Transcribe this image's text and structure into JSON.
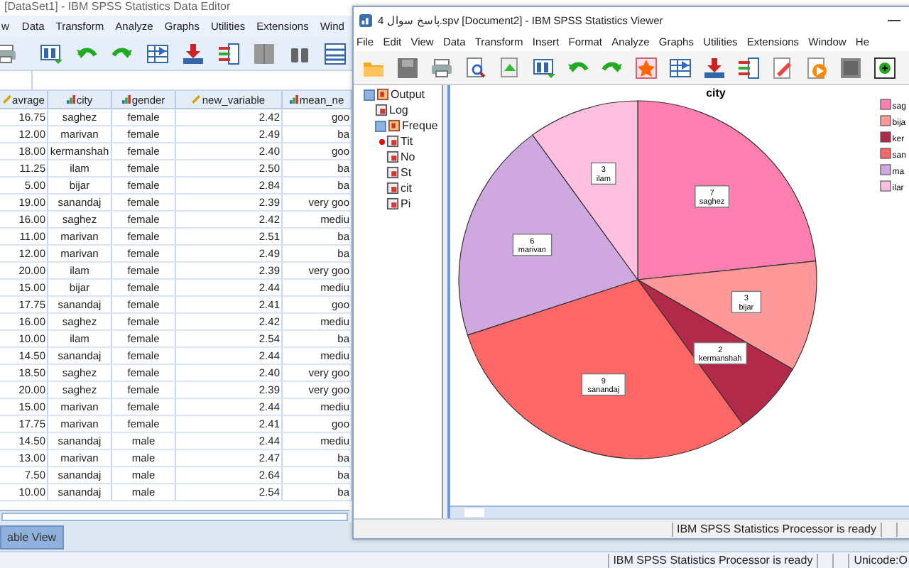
{
  "data_editor": {
    "title": "[DataSet1] - IBM SPSS Statistics Data Editor",
    "menu": [
      "w",
      "Data",
      "Transform",
      "Analyze",
      "Graphs",
      "Utilities",
      "Extensions",
      "Wind"
    ],
    "columns": [
      {
        "label": "avrage",
        "kind": "scale"
      },
      {
        "label": "city",
        "kind": "nominal"
      },
      {
        "label": "gender",
        "kind": "nominal"
      },
      {
        "label": "new_variable",
        "kind": "scale"
      },
      {
        "label": "mean_ne",
        "kind": "nominal"
      }
    ],
    "rows": [
      [
        "16.75",
        "saghez",
        "female",
        "2.42",
        "goo"
      ],
      [
        "12.00",
        "marivan",
        "female",
        "2.49",
        "ba"
      ],
      [
        "18.00",
        "kermanshah",
        "female",
        "2.40",
        "goo"
      ],
      [
        "11.25",
        "ilam",
        "female",
        "2.50",
        "ba"
      ],
      [
        "5.00",
        "bijar",
        "female",
        "2.84",
        "ba"
      ],
      [
        "19.00",
        "sanandaj",
        "female",
        "2.39",
        "very goo"
      ],
      [
        "16.00",
        "saghez",
        "female",
        "2.42",
        "mediu"
      ],
      [
        "11.00",
        "marivan",
        "female",
        "2.51",
        "ba"
      ],
      [
        "12.00",
        "marivan",
        "female",
        "2.49",
        "ba"
      ],
      [
        "20.00",
        "ilam",
        "female",
        "2.39",
        "very goo"
      ],
      [
        "15.00",
        "bijar",
        "female",
        "2.44",
        "mediu"
      ],
      [
        "17.75",
        "sanandaj",
        "female",
        "2.41",
        "goo"
      ],
      [
        "16.00",
        "saghez",
        "female",
        "2.42",
        "mediu"
      ],
      [
        "10.00",
        "ilam",
        "female",
        "2.54",
        "ba"
      ],
      [
        "14.50",
        "sanandaj",
        "female",
        "2.44",
        "mediu"
      ],
      [
        "18.50",
        "saghez",
        "female",
        "2.40",
        "very goo"
      ],
      [
        "20.00",
        "saghez",
        "female",
        "2.39",
        "very goo"
      ],
      [
        "15.00",
        "marivan",
        "female",
        "2.44",
        "mediu"
      ],
      [
        "17.75",
        "marivan",
        "female",
        "2.41",
        "goo"
      ],
      [
        "14.50",
        "sanandaj",
        "male",
        "2.44",
        "mediu"
      ],
      [
        "13.00",
        "marivan",
        "male",
        "2.47",
        "ba"
      ],
      [
        "7.50",
        "sanandaj",
        "male",
        "2.64",
        "ba"
      ],
      [
        "10.00",
        "sanandaj",
        "male",
        "2.54",
        "ba"
      ]
    ],
    "view_tab": {
      "label": "able View",
      "selected": true
    },
    "status_bar": [
      "IBM SPSS Statistics Processor is ready",
      "Unicode:O"
    ]
  },
  "viewer": {
    "title": "پاسخ سوال 4.spv [Document2] - IBM SPSS Statistics Viewer",
    "menu": [
      "File",
      "Edit",
      "View",
      "Data",
      "Transform",
      "Insert",
      "Format",
      "Analyze",
      "Graphs",
      "Utilities",
      "Extensions",
      "Window",
      "He"
    ],
    "outline": [
      {
        "label": "Output",
        "expanded": true,
        "current": false,
        "children": [
          {
            "label": "Log",
            "current": false
          },
          {
            "label": "Freque",
            "expanded": true,
            "current": false,
            "children": [
              {
                "label": "Tit",
                "current": true
              },
              {
                "label": "No",
                "current": false
              },
              {
                "label": "St",
                "current": false
              },
              {
                "label": "cit",
                "current": false
              },
              {
                "label": "Pi",
                "current": false
              }
            ]
          }
        ]
      }
    ],
    "chart": {
      "chart_data": {
        "type": "pie",
        "title": "city",
        "categories": [
          "saghez",
          "bijar",
          "kermanshah",
          "sanandaj",
          "marivan",
          "ilam"
        ],
        "values": [
          7,
          3,
          2,
          9,
          6,
          3
        ],
        "data_labels": true
      },
      "legend": [
        {
          "label": "sag",
          "color": "#ff80b0"
        },
        {
          "label": "bija",
          "color": "#ff9999"
        },
        {
          "label": "ker",
          "color": "#b3294a"
        },
        {
          "label": "san",
          "color": "#ff6666"
        },
        {
          "label": "ma",
          "color": "#cfa8e0"
        },
        {
          "label": "ilar",
          "color": "#ffc0e0"
        }
      ]
    },
    "status_bar": "IBM SPSS Statistics Processor is ready"
  }
}
